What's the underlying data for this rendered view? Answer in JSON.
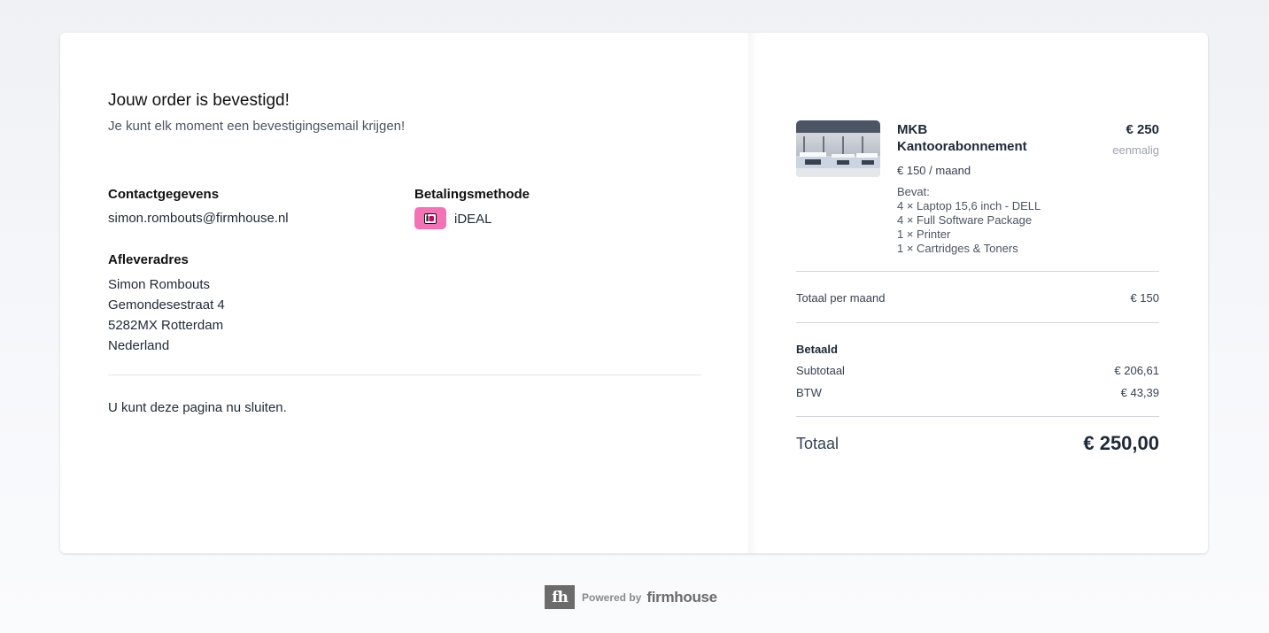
{
  "confirmation": {
    "title": "Jouw order is bevestigd!",
    "subtitle": "Je kunt elk moment een bevestigingsemail krijgen!"
  },
  "contact": {
    "heading": "Contactgegevens",
    "email": "simon.rombouts@firmhouse.nl"
  },
  "payment": {
    "heading": "Betalingsmethode",
    "method": "iDEAL",
    "icon": "ideal-icon",
    "badge_color": "#f472b6"
  },
  "address": {
    "heading": "Afleveradres",
    "lines": [
      "Simon Rombouts",
      "Gemondesestraat 4",
      "5282MX Rotterdam",
      "Nederland"
    ]
  },
  "close_message": "U kunt deze pagina nu sluiten.",
  "product": {
    "name_line1": "MKB",
    "name_line2": "Kantoorabonnement",
    "price": "€ 250",
    "price_note": "eenmalig",
    "recurring": "€ 150 / maand",
    "contains_label": "Bevat:",
    "items": [
      "4 × Laptop 15,6 inch - DELL",
      "4 × Full Software Package",
      "1 × Printer",
      "1 × Cartridges & Toners"
    ]
  },
  "summary": {
    "monthly_label": "Totaal per maand",
    "monthly_value": "€ 150",
    "paid_heading": "Betaald",
    "subtotal_label": "Subtotaal",
    "subtotal_value": "€ 206,61",
    "vat_label": "BTW",
    "vat_value": "€ 43,39",
    "total_label": "Totaal",
    "total_value": "€ 250,00"
  },
  "footer": {
    "logo_text": "fh",
    "powered_by": "Powered by",
    "brand": "firmhouse"
  }
}
